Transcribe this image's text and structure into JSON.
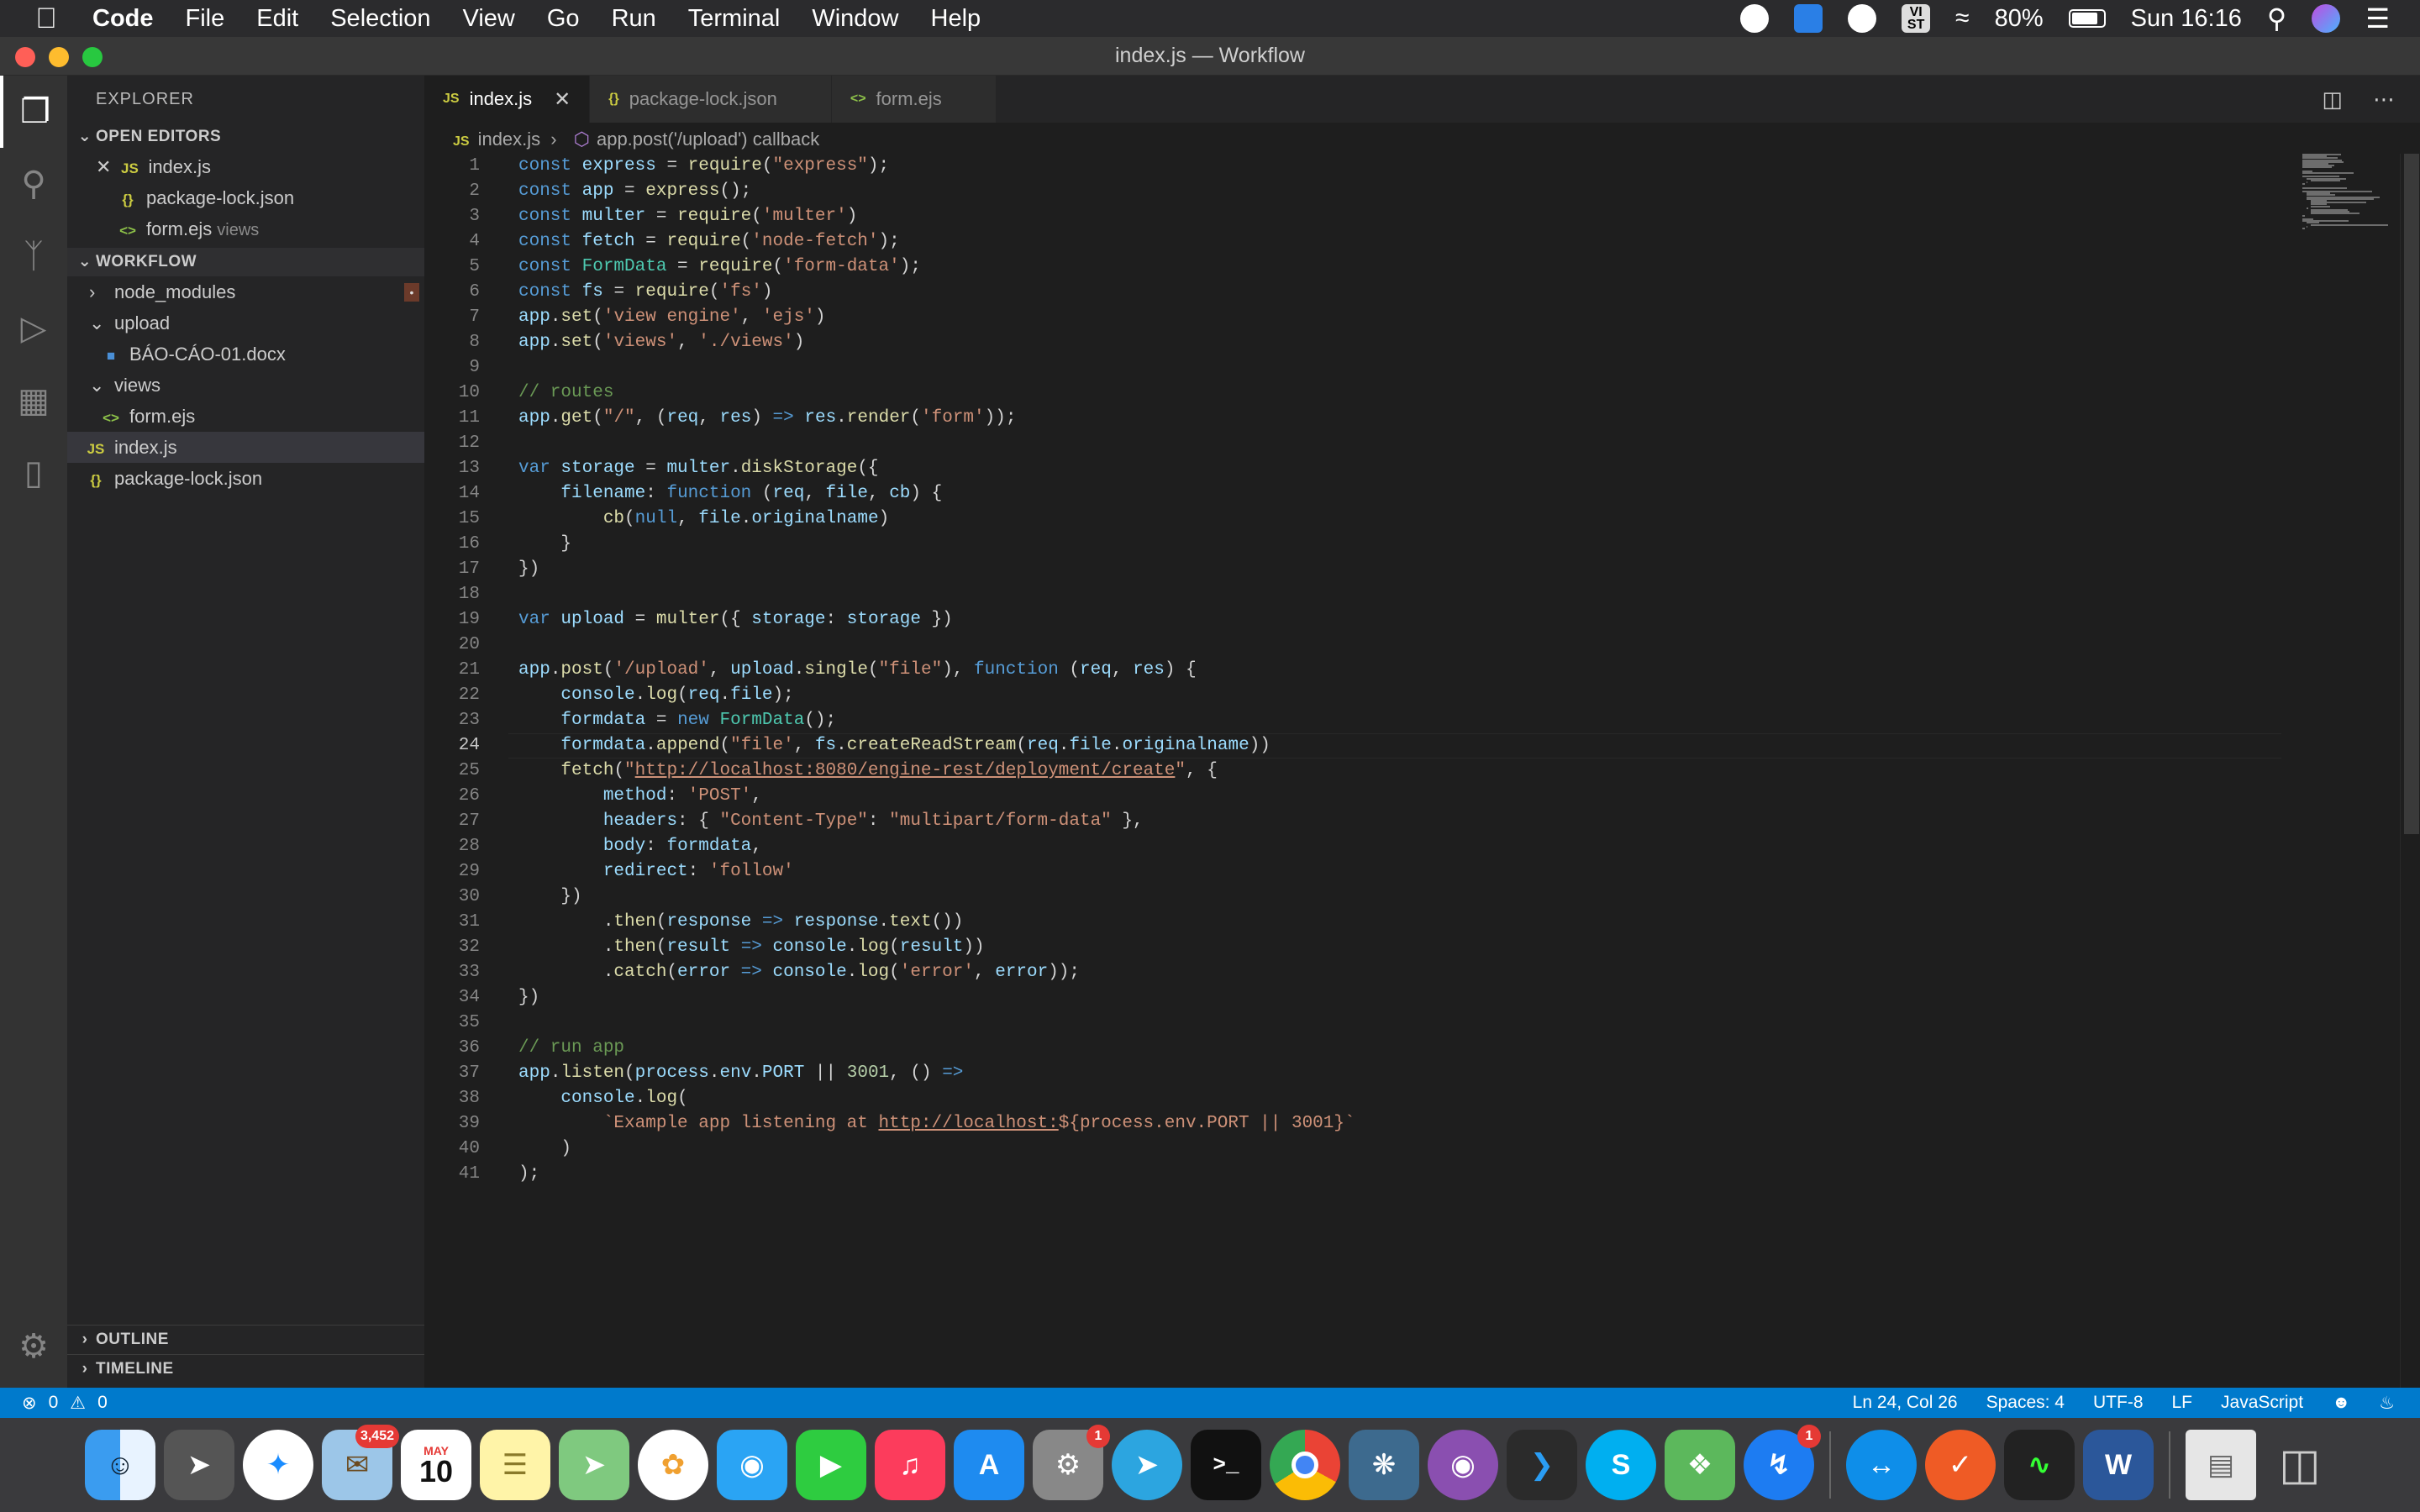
{
  "menubar": {
    "app_name": "Code",
    "items": [
      "File",
      "Edit",
      "Selection",
      "View",
      "Go",
      "Run",
      "Terminal",
      "Window",
      "Help"
    ],
    "status_vi": "VI\nST",
    "battery": "80%",
    "clock": "Sun 16:16"
  },
  "window": {
    "title": "index.js — Workflow"
  },
  "sidebar": {
    "title": "EXPLORER",
    "open_editors_label": "OPEN EDITORS",
    "open_editors": [
      {
        "icon": "JS",
        "name": "index.js",
        "extra": ""
      },
      {
        "icon": "{}",
        "name": "package-lock.json",
        "extra": ""
      },
      {
        "icon": "<>",
        "name": "form.ejs",
        "extra": "views"
      }
    ],
    "workflow_label": "WORKFLOW",
    "tree": [
      {
        "name": "node_modules"
      },
      {
        "name": "upload"
      },
      {
        "name": "BÁO-CÁO-01.docx"
      },
      {
        "name": "views"
      },
      {
        "name": "form.ejs"
      },
      {
        "name": "index.js"
      },
      {
        "name": "package-lock.json"
      }
    ],
    "outline_label": "OUTLINE",
    "timeline_label": "TIMELINE"
  },
  "tabs": [
    {
      "icon": "JS",
      "label": "index.js"
    },
    {
      "icon": "{}",
      "label": "package-lock.json"
    },
    {
      "icon": "<>",
      "label": "form.ejs"
    }
  ],
  "breadcrumb": {
    "file": "index.js",
    "symbol": "app.post('/upload') callback"
  },
  "editor": {
    "current_line": 24,
    "lines": [
      "const express = require(\"express\");",
      "const app = express();",
      "const multer = require('multer')",
      "const fetch = require('node-fetch');",
      "const FormData = require('form-data');",
      "const fs = require('fs')",
      "app.set('view engine', 'ejs')",
      "app.set('views', './views')",
      "",
      "// routes",
      "app.get(\"/\", (req, res) => res.render('form'));",
      "",
      "var storage = multer.diskStorage({",
      "    filename: function (req, file, cb) {",
      "        cb(null, file.originalname)",
      "    }",
      "})",
      "",
      "var upload = multer({ storage: storage })",
      "",
      "app.post('/upload', upload.single(\"file\"), function (req, res) {",
      "    console.log(req.file);",
      "    formdata = new FormData();",
      "    formdata.append(\"file', fs.createReadStream(req.file.originalname))",
      "    fetch(\"http://localhost:8080/engine-rest/deployment/create\", {",
      "        method: 'POST',",
      "        headers: { \"Content-Type\": \"multipart/form-data\" },",
      "        body: formdata,",
      "        redirect: 'follow'",
      "    })",
      "        .then(response => response.text())",
      "        .then(result => console.log(result))",
      "        .catch(error => console.log('error', error));",
      "})",
      "",
      "// run app",
      "app.listen(process.env.PORT || 3001, () =>",
      "    console.log(",
      "        `Example app listening at http://localhost:${process.env.PORT || 3001}`",
      "    )",
      ");"
    ]
  },
  "statusbar": {
    "errors": "0",
    "warnings": "0",
    "position": "Ln 24, Col 26",
    "spaces": "Spaces: 4",
    "encoding": "UTF-8",
    "eol": "LF",
    "language": "JavaScript"
  },
  "dock": {
    "mail_badge": "3,452",
    "calendar_month": "MAY",
    "calendar_day": "10",
    "prefs_badge": "1",
    "messenger_badge": "1",
    "terminal_prompt": ">_",
    "word_letter": "W"
  },
  "colors": {
    "accent": "#007acc",
    "activity_bar": "#333333",
    "sidebar": "#252526",
    "editor": "#1e1e1e"
  }
}
